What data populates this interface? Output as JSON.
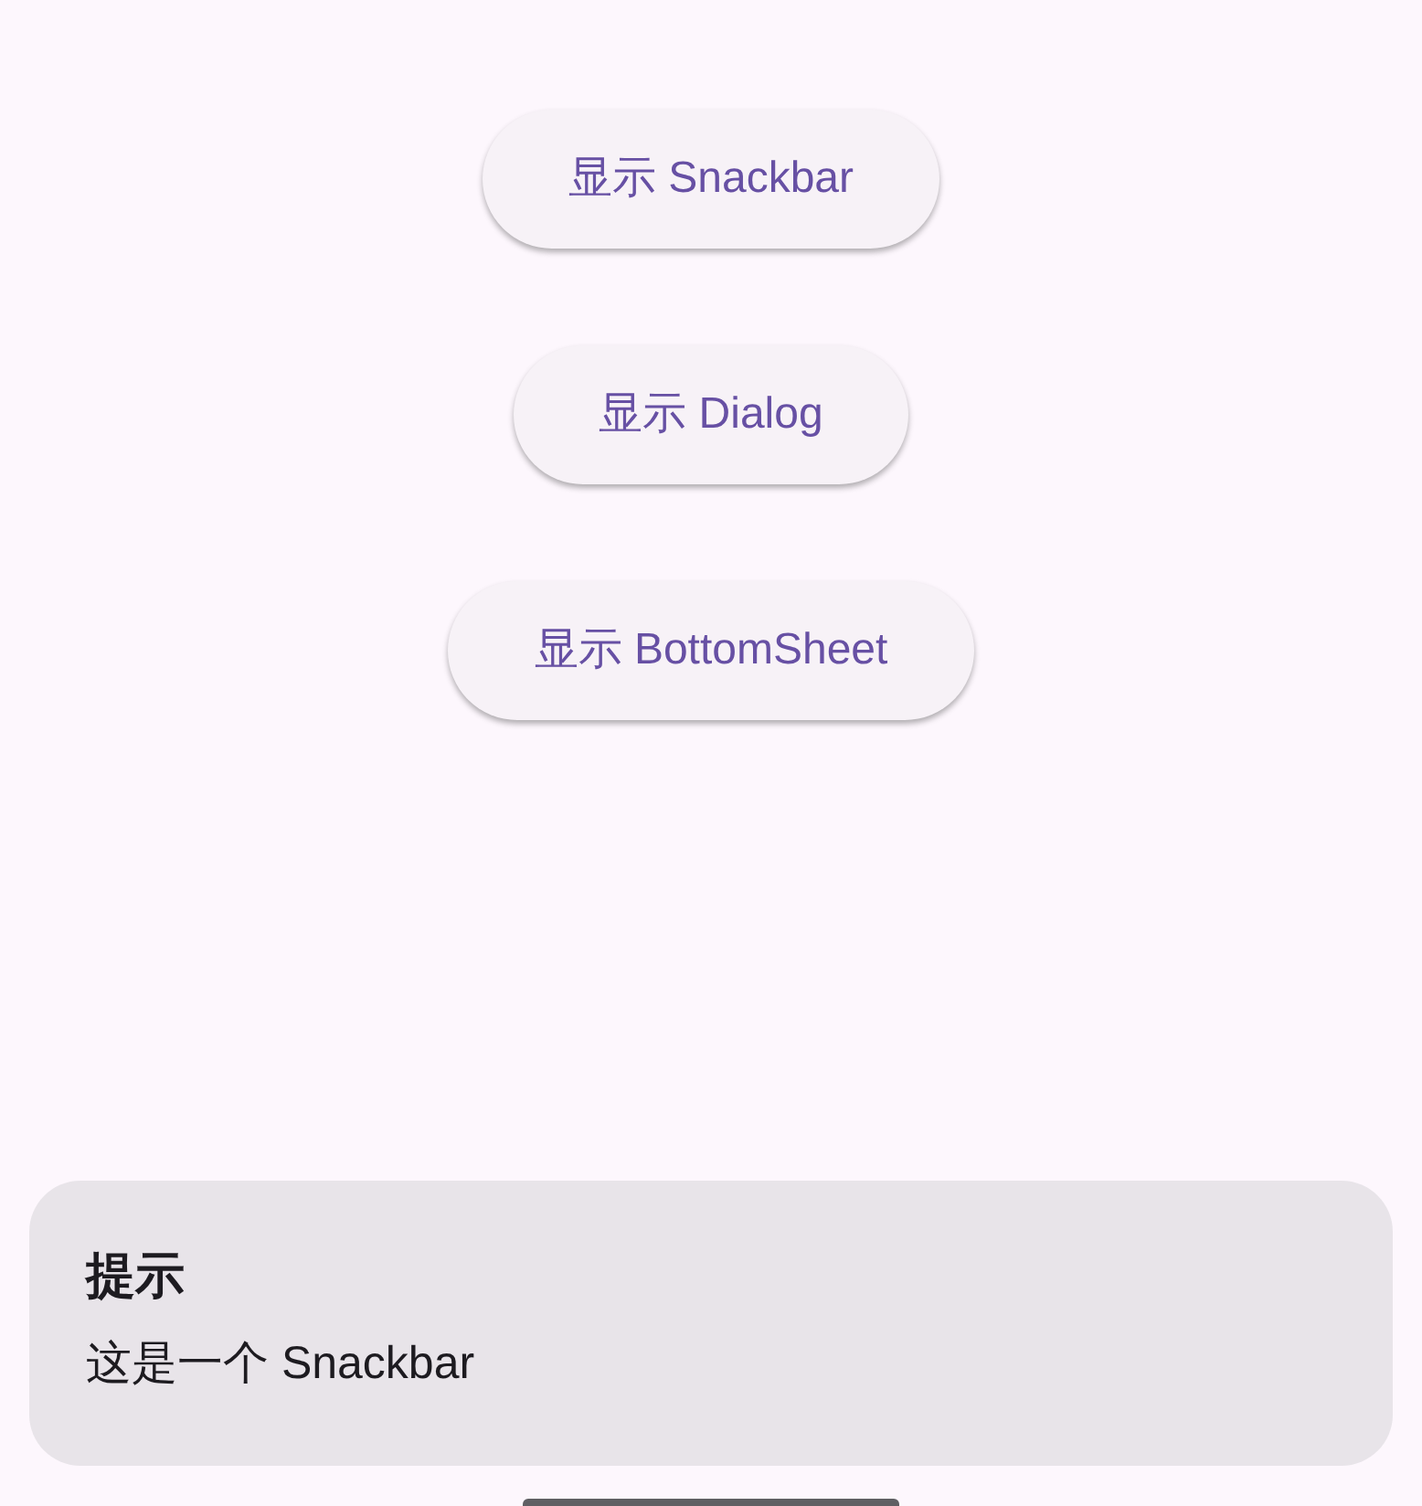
{
  "buttons": [
    {
      "label": "显示 Snackbar"
    },
    {
      "label": "显示 Dialog"
    },
    {
      "label": "显示 BottomSheet"
    }
  ],
  "snackbar": {
    "title": "提示",
    "message": "这是一个 Snackbar"
  }
}
